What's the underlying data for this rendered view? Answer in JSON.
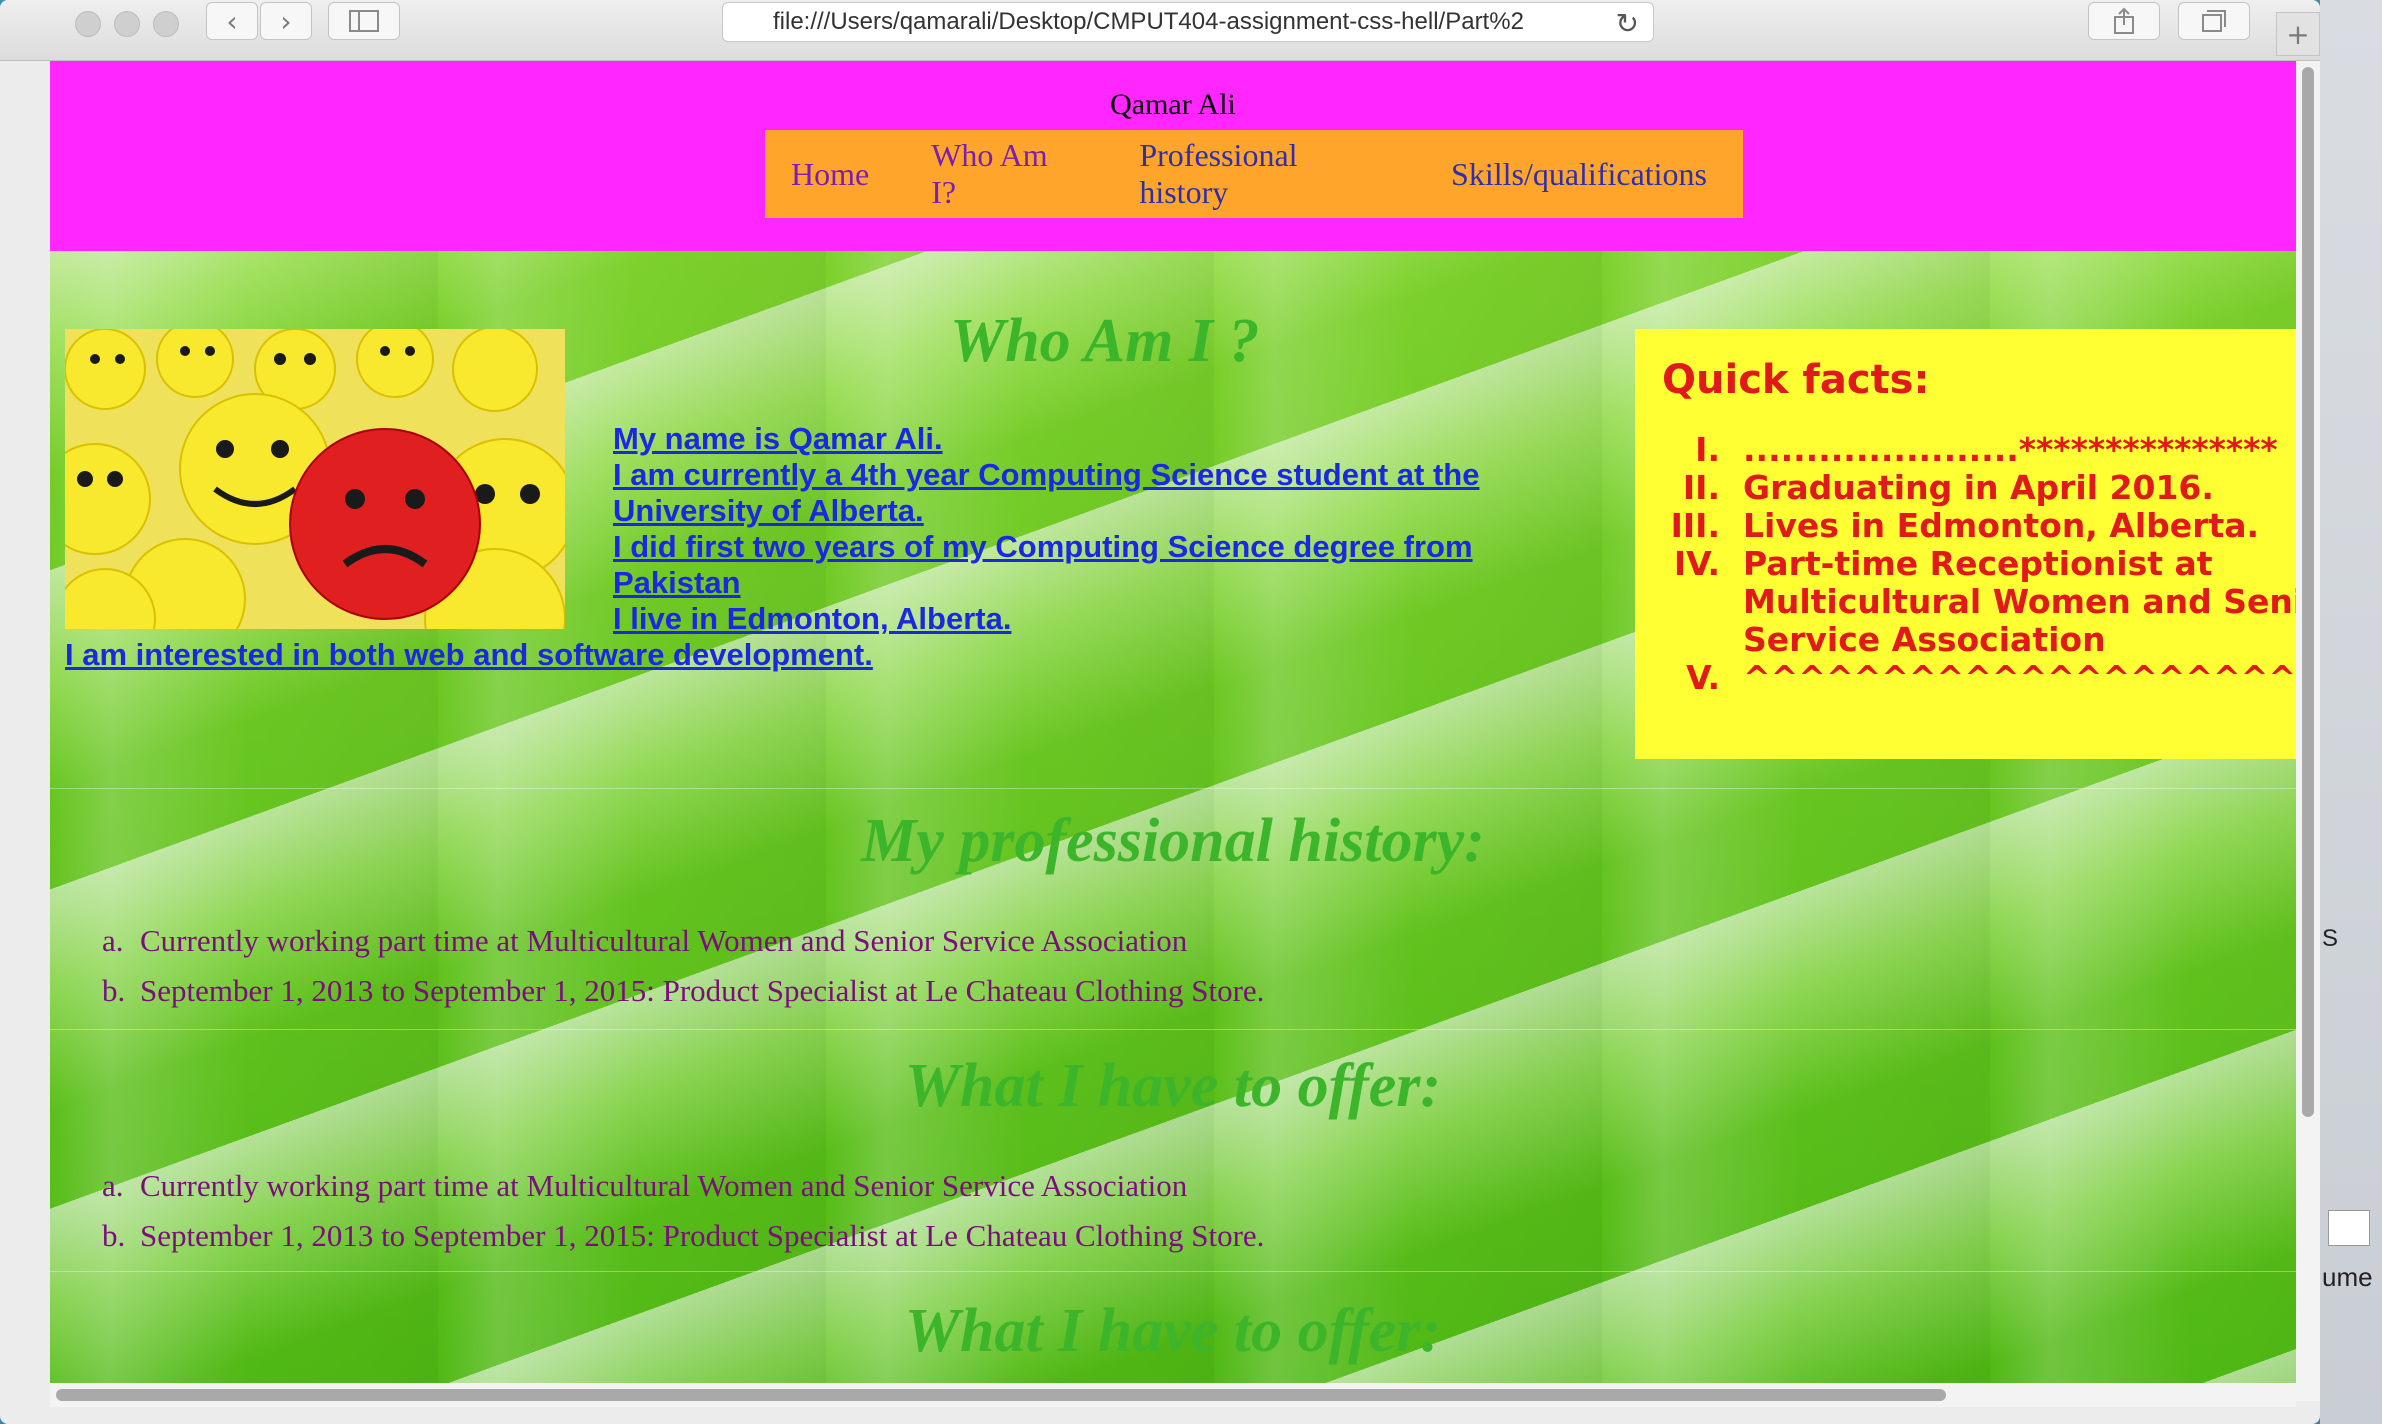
{
  "browser": {
    "url": "file:///Users/qamarali/Desktop/CMPUT404-assignment-css-hell/Part%2",
    "new_tab_symbol": "+"
  },
  "header": {
    "site_name": "Qamar Ali",
    "nav": [
      "Home",
      "Who Am I?",
      "Professional history",
      "Skills/qualifications"
    ]
  },
  "who_am_i": {
    "title": "Who Am I ?",
    "lines": [
      "My name is Qamar Ali. ",
      "I am currently a 4th year Computing Science student at the University of Alberta.",
      "I did first two years of my Computing Science degree from Pakistan ",
      "I live in Edmonton, Alberta. ",
      "I am interested in both web and software development."
    ]
  },
  "quick_facts": {
    "title": "Quick facts:",
    "items": [
      {
        "num": "I.",
        "text": "......................***************"
      },
      {
        "num": "II.",
        "text": "Graduating in April 2016."
      },
      {
        "num": "III.",
        "text": "Lives in Edmonton, Alberta."
      },
      {
        "num": "IV.",
        "text": "Part-time Receptionist at"
      },
      {
        "num": "",
        "text": "Multicultural Women and Senic"
      },
      {
        "num": "",
        "text": "Service Association"
      },
      {
        "num": "V.",
        "text": "^^^^^^^^^^^^^^^^^^^^***********"
      }
    ]
  },
  "professional_history": {
    "title": "My professional history:",
    "items": [
      {
        "num": "a.",
        "text": "Currently working part time at Multicultural Women and Senior Service Association"
      },
      {
        "num": "b.",
        "text": "September 1, 2013 to September 1, 2015: Product Specialist at Le Chateau Clothing Store."
      }
    ]
  },
  "offer": {
    "title": "What I have to offer:",
    "items": [
      {
        "num": "a.",
        "text": "Currently working part time at Multicultural Women and Senior Service Association"
      },
      {
        "num": "b.",
        "text": "September 1, 2013 to September 1, 2015: Product Specialist at Le Chateau Clothing Store."
      }
    ]
  },
  "offer2": {
    "title": "What I have to offer:"
  },
  "desktop_peek": {
    "text_a": "S",
    "text_b": "ume"
  }
}
